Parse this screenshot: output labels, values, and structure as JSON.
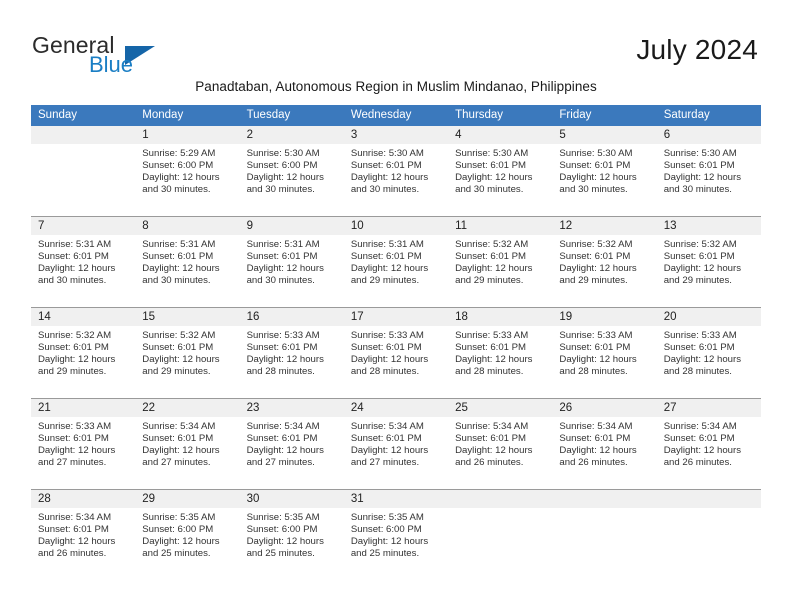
{
  "brand": {
    "name_part1": "General",
    "name_part2": "Blue",
    "triangle_color": "#1565a8",
    "blue_color": "#1a7ec4"
  },
  "header": {
    "month_title": "July 2024",
    "subtitle": "Panadtaban, Autonomous Region in Muslim Mindanao, Philippines",
    "header_bg": "#3b79bd",
    "daynum_bg": "#f0f0f0"
  },
  "weekday_headers": [
    "Sunday",
    "Monday",
    "Tuesday",
    "Wednesday",
    "Thursday",
    "Friday",
    "Saturday"
  ],
  "weeks": [
    [
      {
        "day": "",
        "empty": true,
        "sunrise": "",
        "sunset": "",
        "daylight1": "",
        "daylight2": ""
      },
      {
        "day": "1",
        "sunrise": "Sunrise: 5:29 AM",
        "sunset": "Sunset: 6:00 PM",
        "daylight1": "Daylight: 12 hours",
        "daylight2": "and 30 minutes."
      },
      {
        "day": "2",
        "sunrise": "Sunrise: 5:30 AM",
        "sunset": "Sunset: 6:00 PM",
        "daylight1": "Daylight: 12 hours",
        "daylight2": "and 30 minutes."
      },
      {
        "day": "3",
        "sunrise": "Sunrise: 5:30 AM",
        "sunset": "Sunset: 6:01 PM",
        "daylight1": "Daylight: 12 hours",
        "daylight2": "and 30 minutes."
      },
      {
        "day": "4",
        "sunrise": "Sunrise: 5:30 AM",
        "sunset": "Sunset: 6:01 PM",
        "daylight1": "Daylight: 12 hours",
        "daylight2": "and 30 minutes."
      },
      {
        "day": "5",
        "sunrise": "Sunrise: 5:30 AM",
        "sunset": "Sunset: 6:01 PM",
        "daylight1": "Daylight: 12 hours",
        "daylight2": "and 30 minutes."
      },
      {
        "day": "6",
        "sunrise": "Sunrise: 5:30 AM",
        "sunset": "Sunset: 6:01 PM",
        "daylight1": "Daylight: 12 hours",
        "daylight2": "and 30 minutes."
      }
    ],
    [
      {
        "day": "7",
        "sunrise": "Sunrise: 5:31 AM",
        "sunset": "Sunset: 6:01 PM",
        "daylight1": "Daylight: 12 hours",
        "daylight2": "and 30 minutes."
      },
      {
        "day": "8",
        "sunrise": "Sunrise: 5:31 AM",
        "sunset": "Sunset: 6:01 PM",
        "daylight1": "Daylight: 12 hours",
        "daylight2": "and 30 minutes."
      },
      {
        "day": "9",
        "sunrise": "Sunrise: 5:31 AM",
        "sunset": "Sunset: 6:01 PM",
        "daylight1": "Daylight: 12 hours",
        "daylight2": "and 30 minutes."
      },
      {
        "day": "10",
        "sunrise": "Sunrise: 5:31 AM",
        "sunset": "Sunset: 6:01 PM",
        "daylight1": "Daylight: 12 hours",
        "daylight2": "and 29 minutes."
      },
      {
        "day": "11",
        "sunrise": "Sunrise: 5:32 AM",
        "sunset": "Sunset: 6:01 PM",
        "daylight1": "Daylight: 12 hours",
        "daylight2": "and 29 minutes."
      },
      {
        "day": "12",
        "sunrise": "Sunrise: 5:32 AM",
        "sunset": "Sunset: 6:01 PM",
        "daylight1": "Daylight: 12 hours",
        "daylight2": "and 29 minutes."
      },
      {
        "day": "13",
        "sunrise": "Sunrise: 5:32 AM",
        "sunset": "Sunset: 6:01 PM",
        "daylight1": "Daylight: 12 hours",
        "daylight2": "and 29 minutes."
      }
    ],
    [
      {
        "day": "14",
        "sunrise": "Sunrise: 5:32 AM",
        "sunset": "Sunset: 6:01 PM",
        "daylight1": "Daylight: 12 hours",
        "daylight2": "and 29 minutes."
      },
      {
        "day": "15",
        "sunrise": "Sunrise: 5:32 AM",
        "sunset": "Sunset: 6:01 PM",
        "daylight1": "Daylight: 12 hours",
        "daylight2": "and 29 minutes."
      },
      {
        "day": "16",
        "sunrise": "Sunrise: 5:33 AM",
        "sunset": "Sunset: 6:01 PM",
        "daylight1": "Daylight: 12 hours",
        "daylight2": "and 28 minutes."
      },
      {
        "day": "17",
        "sunrise": "Sunrise: 5:33 AM",
        "sunset": "Sunset: 6:01 PM",
        "daylight1": "Daylight: 12 hours",
        "daylight2": "and 28 minutes."
      },
      {
        "day": "18",
        "sunrise": "Sunrise: 5:33 AM",
        "sunset": "Sunset: 6:01 PM",
        "daylight1": "Daylight: 12 hours",
        "daylight2": "and 28 minutes."
      },
      {
        "day": "19",
        "sunrise": "Sunrise: 5:33 AM",
        "sunset": "Sunset: 6:01 PM",
        "daylight1": "Daylight: 12 hours",
        "daylight2": "and 28 minutes."
      },
      {
        "day": "20",
        "sunrise": "Sunrise: 5:33 AM",
        "sunset": "Sunset: 6:01 PM",
        "daylight1": "Daylight: 12 hours",
        "daylight2": "and 28 minutes."
      }
    ],
    [
      {
        "day": "21",
        "sunrise": "Sunrise: 5:33 AM",
        "sunset": "Sunset: 6:01 PM",
        "daylight1": "Daylight: 12 hours",
        "daylight2": "and 27 minutes."
      },
      {
        "day": "22",
        "sunrise": "Sunrise: 5:34 AM",
        "sunset": "Sunset: 6:01 PM",
        "daylight1": "Daylight: 12 hours",
        "daylight2": "and 27 minutes."
      },
      {
        "day": "23",
        "sunrise": "Sunrise: 5:34 AM",
        "sunset": "Sunset: 6:01 PM",
        "daylight1": "Daylight: 12 hours",
        "daylight2": "and 27 minutes."
      },
      {
        "day": "24",
        "sunrise": "Sunrise: 5:34 AM",
        "sunset": "Sunset: 6:01 PM",
        "daylight1": "Daylight: 12 hours",
        "daylight2": "and 27 minutes."
      },
      {
        "day": "25",
        "sunrise": "Sunrise: 5:34 AM",
        "sunset": "Sunset: 6:01 PM",
        "daylight1": "Daylight: 12 hours",
        "daylight2": "and 26 minutes."
      },
      {
        "day": "26",
        "sunrise": "Sunrise: 5:34 AM",
        "sunset": "Sunset: 6:01 PM",
        "daylight1": "Daylight: 12 hours",
        "daylight2": "and 26 minutes."
      },
      {
        "day": "27",
        "sunrise": "Sunrise: 5:34 AM",
        "sunset": "Sunset: 6:01 PM",
        "daylight1": "Daylight: 12 hours",
        "daylight2": "and 26 minutes."
      }
    ],
    [
      {
        "day": "28",
        "sunrise": "Sunrise: 5:34 AM",
        "sunset": "Sunset: 6:01 PM",
        "daylight1": "Daylight: 12 hours",
        "daylight2": "and 26 minutes."
      },
      {
        "day": "29",
        "sunrise": "Sunrise: 5:35 AM",
        "sunset": "Sunset: 6:00 PM",
        "daylight1": "Daylight: 12 hours",
        "daylight2": "and 25 minutes."
      },
      {
        "day": "30",
        "sunrise": "Sunrise: 5:35 AM",
        "sunset": "Sunset: 6:00 PM",
        "daylight1": "Daylight: 12 hours",
        "daylight2": "and 25 minutes."
      },
      {
        "day": "31",
        "sunrise": "Sunrise: 5:35 AM",
        "sunset": "Sunset: 6:00 PM",
        "daylight1": "Daylight: 12 hours",
        "daylight2": "and 25 minutes."
      },
      {
        "day": "",
        "empty": true,
        "sunrise": "",
        "sunset": "",
        "daylight1": "",
        "daylight2": ""
      },
      {
        "day": "",
        "empty": true,
        "sunrise": "",
        "sunset": "",
        "daylight1": "",
        "daylight2": ""
      },
      {
        "day": "",
        "empty": true,
        "sunrise": "",
        "sunset": "",
        "daylight1": "",
        "daylight2": ""
      }
    ]
  ]
}
